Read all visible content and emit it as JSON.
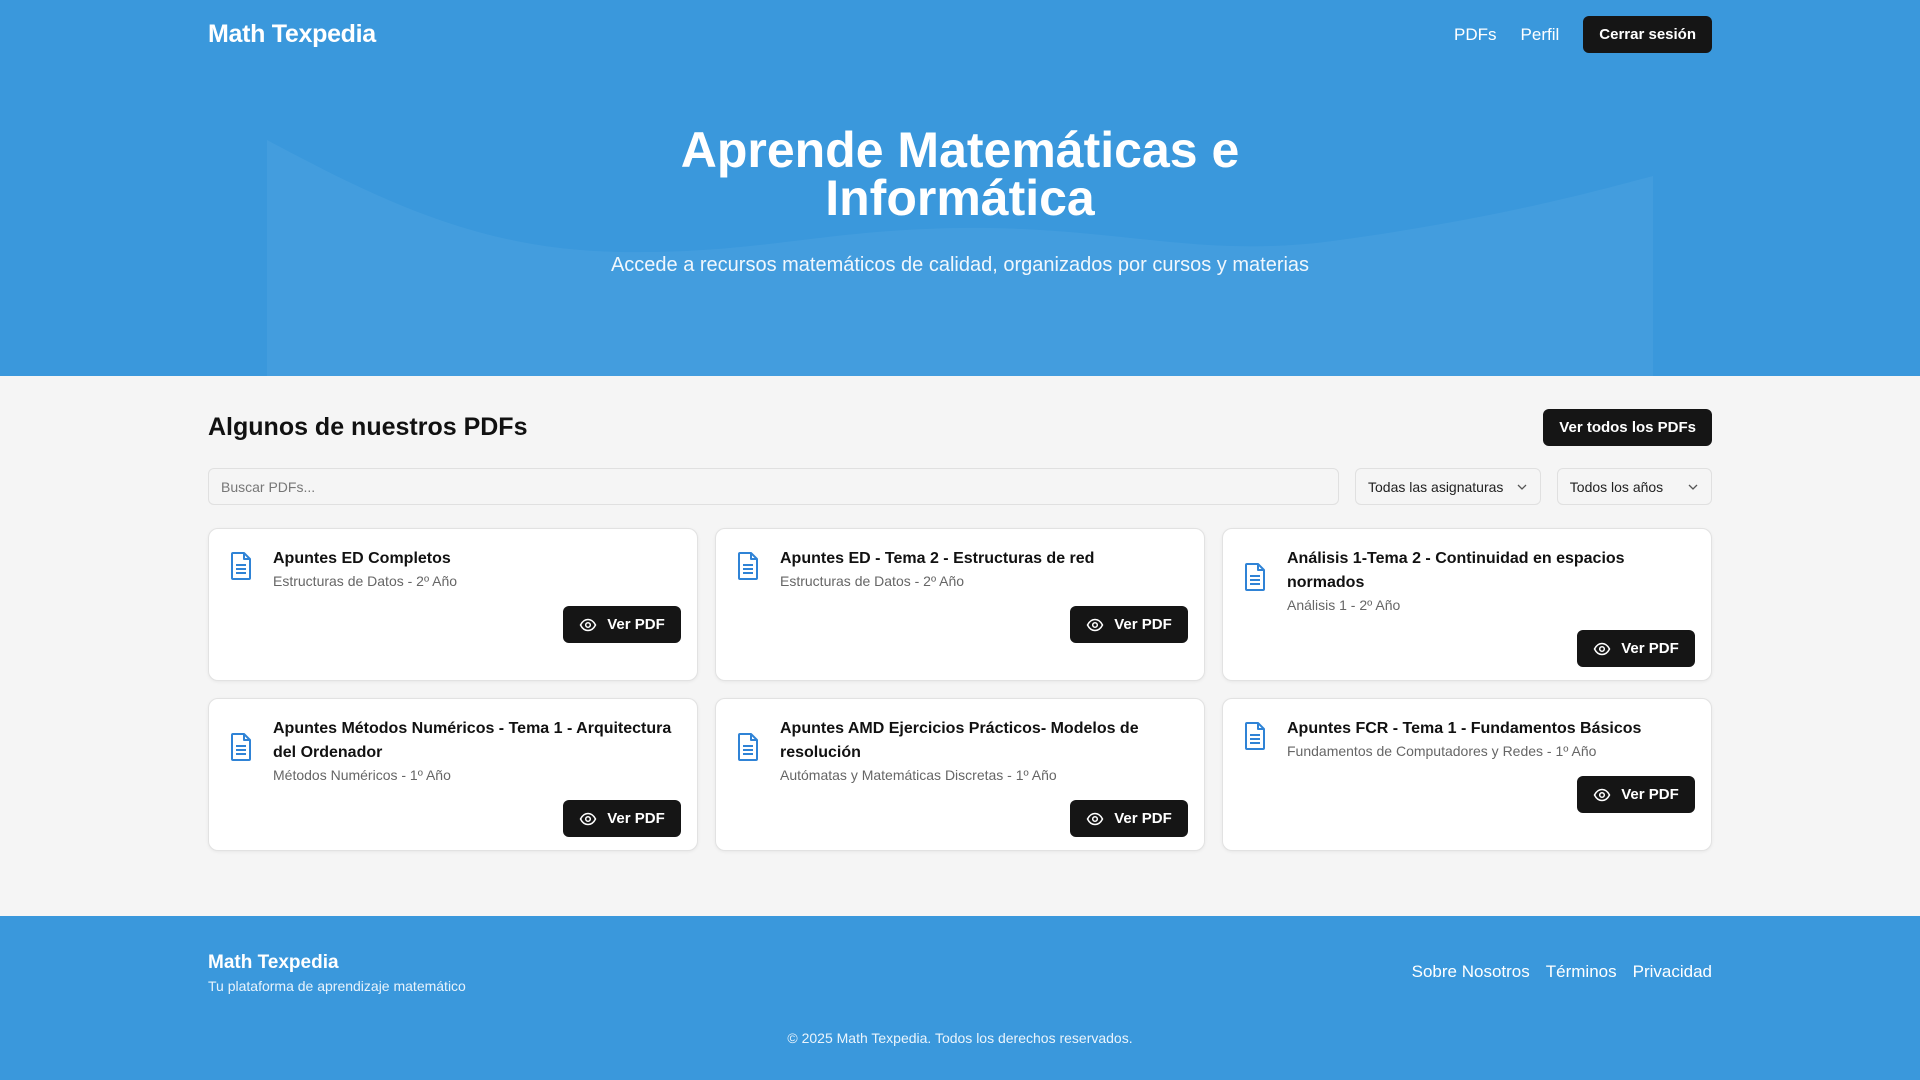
{
  "header": {
    "logo": "Math Texpedia",
    "nav": [
      "PDFs",
      "Perfil"
    ],
    "logout_label": "Cerrar sesión"
  },
  "hero": {
    "title_line1": "Aprende Matemáticas e",
    "title_line2": "Informática",
    "subtitle": "Accede a recursos matemáticos de calidad, organizados por cursos y materias"
  },
  "section": {
    "title": "Algunos de nuestros PDFs",
    "all_button": "Ver todos los PDFs"
  },
  "filters": {
    "search_placeholder": "Buscar PDFs...",
    "subject_selected": "Todas las asignaturas",
    "year_selected": "Todos los años"
  },
  "cards": [
    {
      "title": "Apuntes ED Completos",
      "meta": "Estructuras de Datos - 2º Año",
      "button": "Ver PDF"
    },
    {
      "title": "Apuntes ED - Tema 2 - Estructuras de red",
      "meta": "Estructuras de Datos - 2º Año",
      "button": "Ver PDF"
    },
    {
      "title": "Análisis 1-Tema 2 - Continuidad en espacios normados",
      "meta": "Análisis 1 - 2º Año",
      "button": "Ver PDF"
    },
    {
      "title": "Apuntes Métodos Numéricos - Tema 1 - Arquitectura del Ordenador",
      "meta": "Métodos Numéricos - 1º Año",
      "button": "Ver PDF"
    },
    {
      "title": "Apuntes AMD Ejercicios Prácticos- Modelos de resolución",
      "meta": "Autómatas y Matemáticas Discretas - 1º Año",
      "button": "Ver PDF"
    },
    {
      "title": "Apuntes FCR - Tema 1 - Fundamentos Básicos",
      "meta": "Fundamentos de Computadores y Redes - 1º Año",
      "button": "Ver PDF"
    }
  ],
  "footer": {
    "brand": "Math Texpedia",
    "tagline": "Tu plataforma de aprendizaje matemático",
    "links": [
      "Sobre Nosotros",
      "Términos",
      "Privacidad"
    ],
    "copyright": "© 2025 Math Texpedia. Todos los derechos reservados."
  },
  "icons": {
    "card_icon": "document-icon",
    "button_icon": "eye-icon",
    "select_icon": "chevron-down-icon"
  },
  "colors": {
    "primary": "#3a98dc",
    "dark_button": "#151515",
    "icon_blue": "#2f83d6"
  }
}
